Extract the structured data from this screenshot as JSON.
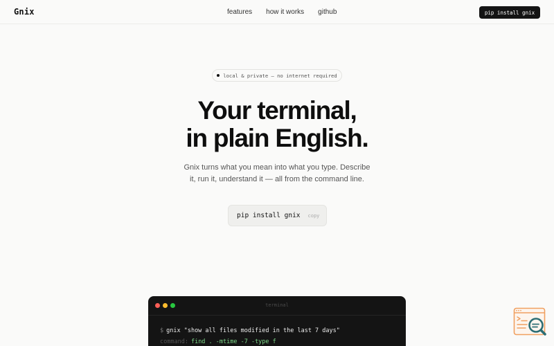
{
  "nav": {
    "logo": "Gnix",
    "links": [
      "features",
      "how it works",
      "github"
    ],
    "cta": "pip install gnix"
  },
  "hero": {
    "badge": "local & private — no internet required",
    "title_lines": [
      "Your terminal,",
      "in plain English."
    ],
    "subtitle_lines": [
      "Gnix turns what you mean into what you type. Describe",
      "it, run it, understand it — all from the command line."
    ],
    "install_command": "pip install gnix",
    "copy_label": "copy"
  },
  "terminal": {
    "title": "terminal",
    "prompt": "$",
    "user_command": "gnix \"show all files modified in the last 7 days\"",
    "command_label": "command:",
    "generated_command": "find . -mtime -7 -type f"
  },
  "colors": {
    "background": "#fafaf9",
    "terminal_bg": "#141414",
    "accent_green": "#7fd88a",
    "widget_orange": "#f0a060",
    "widget_teal": "#2c6e74"
  },
  "icons": {
    "help_widget": "search-document-icon"
  }
}
